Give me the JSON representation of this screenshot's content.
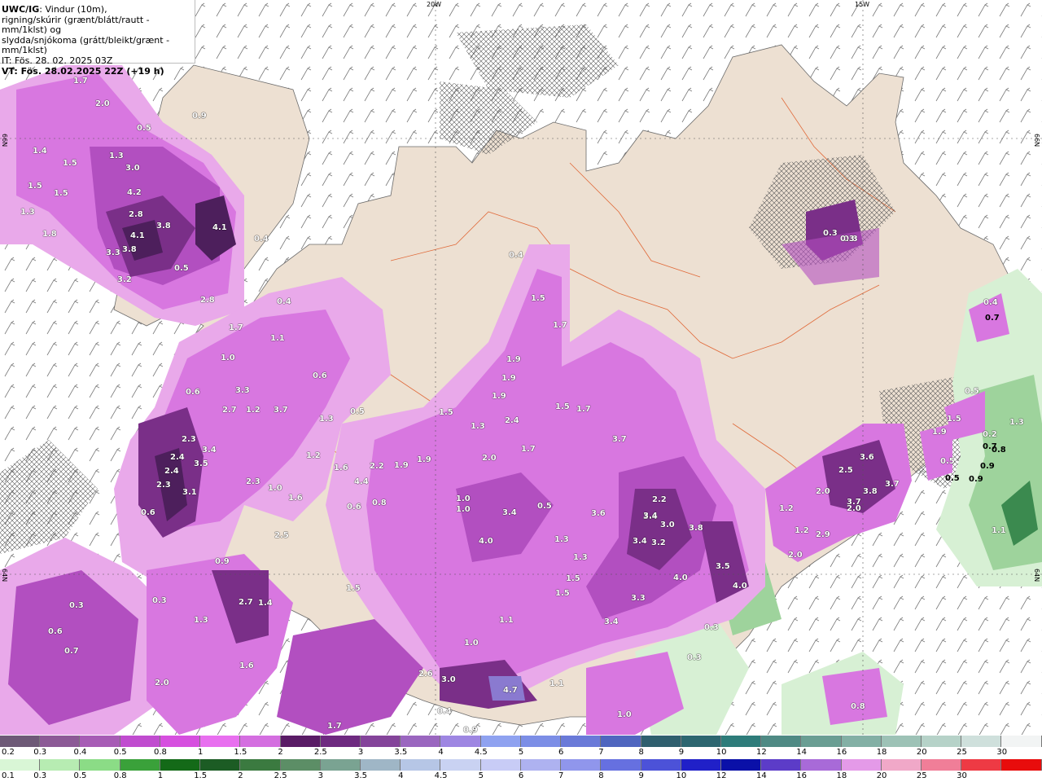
{
  "header": {
    "line1_bold": "UWC/IG",
    "line1_rest": ": Vindur (10m),",
    "line2": "rigning/skúrir (grænt/blátt/rautt - mm/1klst) og",
    "line3": "slydda/snjókoma (grátt/bleikt/grænt - mm/1klst)",
    "line4": "IT: Fös. 28. 02. 2025 03Z",
    "line5": "VT: Fös. 28.02.2025 22Z (+19 h)"
  },
  "grid_labels": {
    "lon_20w": "20W",
    "lon_15w": "15W",
    "lat_66n_left": "66N",
    "lat_66n_right": "66N",
    "lat_64n_left": "64N",
    "lat_64n_right": "64N"
  },
  "map_colors": {
    "sea": "#ffffff",
    "land": "#ede0d2",
    "roads": "#e06a3a",
    "snow_light": "#e9a9ea",
    "snow_mid": "#d877e0",
    "snow_strong": "#b24fc0",
    "snow_heavy": "#7a2f88",
    "snow_max": "#4d1f5c",
    "rain_light": "#d7f0d4",
    "rain_mid": "#9ed39c",
    "rain_heavy": "#3b8a4f"
  },
  "precip_labels": [
    {
      "text": "1.7",
      "c": "w"
    },
    {
      "text": "2.0",
      "c": "w"
    },
    {
      "text": "0.5",
      "c": "w"
    },
    {
      "text": "0.9",
      "c": "w"
    },
    {
      "text": "1.4",
      "c": "w"
    },
    {
      "text": "1.3",
      "c": "w"
    },
    {
      "text": "1.5",
      "c": "w"
    },
    {
      "text": "3.0",
      "c": "w"
    },
    {
      "text": "1.5",
      "c": "w"
    },
    {
      "text": "1.5",
      "c": "w"
    },
    {
      "text": "4.2",
      "c": "w"
    },
    {
      "text": "1.3",
      "c": "w"
    },
    {
      "text": "2.8",
      "c": "w"
    },
    {
      "text": "3.8",
      "c": "w"
    },
    {
      "text": "4.1",
      "c": "w"
    },
    {
      "text": "1.8",
      "c": "w"
    },
    {
      "text": "4.1",
      "c": "w"
    },
    {
      "text": "0.4",
      "c": "w"
    },
    {
      "text": "3.3",
      "c": "w"
    },
    {
      "text": "3.8",
      "c": "w"
    },
    {
      "text": "0.5",
      "c": "w"
    },
    {
      "text": "3.2",
      "c": "w"
    },
    {
      "text": "2.8",
      "c": "w"
    },
    {
      "text": "0.4",
      "c": "w"
    },
    {
      "text": "1.7",
      "c": "w"
    },
    {
      "text": "0.3",
      "c": "w"
    },
    {
      "text": "0.3",
      "c": "w"
    },
    {
      "text": "0.4",
      "c": "w"
    },
    {
      "text": "1.5",
      "c": "w"
    },
    {
      "text": "1.7",
      "c": "w"
    },
    {
      "text": "1.1",
      "c": "w"
    },
    {
      "text": "1.0",
      "c": "w"
    },
    {
      "text": "1.9",
      "c": "w"
    },
    {
      "text": "0.6",
      "c": "w"
    },
    {
      "text": "1.9",
      "c": "w"
    },
    {
      "text": "3.3",
      "c": "w"
    },
    {
      "text": "0.6",
      "c": "w"
    },
    {
      "text": "1.2",
      "c": "w"
    },
    {
      "text": "2.7",
      "c": "w"
    },
    {
      "text": "3.7",
      "c": "w"
    },
    {
      "text": "1.3",
      "c": "w"
    },
    {
      "text": "0.5",
      "c": "w"
    },
    {
      "text": "1.9",
      "c": "w"
    },
    {
      "text": "1.5",
      "c": "w"
    },
    {
      "text": "1.7",
      "c": "w"
    },
    {
      "text": "2.4",
      "c": "w"
    },
    {
      "text": "1.3",
      "c": "w"
    },
    {
      "text": "3.7",
      "c": "w"
    },
    {
      "text": "2.3",
      "c": "w"
    },
    {
      "text": "3.4",
      "c": "w"
    },
    {
      "text": "1.5",
      "c": "w"
    },
    {
      "text": "1.7",
      "c": "w"
    },
    {
      "text": "2.4",
      "c": "w"
    },
    {
      "text": "3.5",
      "c": "w"
    },
    {
      "text": "1.2",
      "c": "w"
    },
    {
      "text": "1.6",
      "c": "w"
    },
    {
      "text": "2.2",
      "c": "w"
    },
    {
      "text": "1.9",
      "c": "w"
    },
    {
      "text": "1.9",
      "c": "w"
    },
    {
      "text": "2.0",
      "c": "w"
    },
    {
      "text": "2.4",
      "c": "w"
    },
    {
      "text": "2.3",
      "c": "w"
    },
    {
      "text": "4.4",
      "c": "w"
    },
    {
      "text": "2.3",
      "c": "w"
    },
    {
      "text": "3.1",
      "c": "w"
    },
    {
      "text": "1.0",
      "c": "w"
    },
    {
      "text": "1.6",
      "c": "w"
    },
    {
      "text": "0.8",
      "c": "w"
    },
    {
      "text": "0.6",
      "c": "w"
    },
    {
      "text": "1.0",
      "c": "w"
    },
    {
      "text": "1.0",
      "c": "w"
    },
    {
      "text": "3.4",
      "c": "w"
    },
    {
      "text": "0.5",
      "c": "w"
    },
    {
      "text": "0.6",
      "c": "w"
    },
    {
      "text": "3.6",
      "c": "w"
    },
    {
      "text": "2.2",
      "c": "w"
    },
    {
      "text": "3.4",
      "c": "w"
    },
    {
      "text": "2.5",
      "c": "w"
    },
    {
      "text": "4.0",
      "c": "w"
    },
    {
      "text": "1.3",
      "c": "w"
    },
    {
      "text": "3.4",
      "c": "w"
    },
    {
      "text": "3.0",
      "c": "w"
    },
    {
      "text": "3.8",
      "c": "w"
    },
    {
      "text": "3.4",
      "c": "w"
    },
    {
      "text": "3.2",
      "c": "w"
    },
    {
      "text": "0.9",
      "c": "w"
    },
    {
      "text": "1.3",
      "c": "w"
    },
    {
      "text": "1.5",
      "c": "w"
    },
    {
      "text": "3.5",
      "c": "w"
    },
    {
      "text": "1.5",
      "c": "w"
    },
    {
      "text": "1.5",
      "c": "w"
    },
    {
      "text": "4.0",
      "c": "w"
    },
    {
      "text": "4.0",
      "c": "w"
    },
    {
      "text": "0.3",
      "c": "w"
    },
    {
      "text": "2.7",
      "c": "w"
    },
    {
      "text": "1.4",
      "c": "w"
    },
    {
      "text": "0.3",
      "c": "w"
    },
    {
      "text": "3.3",
      "c": "w"
    },
    {
      "text": "1.3",
      "c": "w"
    },
    {
      "text": "1.1",
      "c": "w"
    },
    {
      "text": "3.4",
      "c": "w"
    },
    {
      "text": "0.3",
      "c": "w"
    },
    {
      "text": "0.6",
      "c": "w"
    },
    {
      "text": "0.7",
      "c": "w"
    },
    {
      "text": "1.0",
      "c": "w"
    },
    {
      "text": "0.3",
      "c": "w"
    },
    {
      "text": "1.6",
      "c": "w"
    },
    {
      "text": "2.6",
      "c": "w"
    },
    {
      "text": "3.0",
      "c": "w"
    },
    {
      "text": "4.7",
      "c": "w"
    },
    {
      "text": "1.1",
      "c": "w"
    },
    {
      "text": "2.0",
      "c": "w"
    },
    {
      "text": "0.4",
      "c": "w"
    },
    {
      "text": "1.0",
      "c": "w"
    },
    {
      "text": "1.7",
      "c": "w"
    },
    {
      "text": "0.9",
      "c": "w"
    },
    {
      "text": "0.8",
      "c": "w"
    },
    {
      "text": "0.3",
      "c": "w"
    },
    {
      "text": "0.4",
      "c": "w"
    },
    {
      "text": "0.7",
      "c": "d"
    },
    {
      "text": "0.5",
      "c": "w"
    },
    {
      "text": "0.5",
      "c": "w"
    },
    {
      "text": "1.3",
      "c": "w"
    },
    {
      "text": "1.5",
      "c": "w"
    },
    {
      "text": "0.2",
      "c": "w"
    },
    {
      "text": "1.9",
      "c": "w"
    },
    {
      "text": "0.7",
      "c": "d"
    },
    {
      "text": "3.6",
      "c": "w"
    },
    {
      "text": "0.8",
      "c": "d"
    },
    {
      "text": "2.5",
      "c": "w"
    },
    {
      "text": "3.7",
      "c": "w"
    },
    {
      "text": "0.5",
      "c": "d"
    },
    {
      "text": "0.9",
      "c": "d"
    },
    {
      "text": "3.7",
      "c": "w"
    },
    {
      "text": "2.0",
      "c": "w"
    },
    {
      "text": "3.8",
      "c": "w"
    },
    {
      "text": "0.9",
      "c": "d"
    },
    {
      "text": "1.2",
      "c": "w"
    },
    {
      "text": "2.0",
      "c": "w"
    },
    {
      "text": "1.2",
      "c": "w"
    },
    {
      "text": "2.9",
      "c": "w"
    },
    {
      "text": "2.0",
      "c": "w"
    },
    {
      "text": "1.1",
      "c": "w"
    },
    {
      "text": "1.0",
      "c": "d"
    }
  ],
  "legend": {
    "snow": {
      "labels": [
        "0.2",
        "0.3",
        "0.4",
        "0.5",
        "0.8",
        "1",
        "1.5",
        "2",
        "2.5",
        "3",
        "3.5",
        "4",
        "4.5",
        "5",
        "6",
        "7",
        "8",
        "9",
        "10",
        "12",
        "14",
        "16",
        "18",
        "20",
        "25",
        "30"
      ],
      "colors": [
        "#6e5a77",
        "#8c5a96",
        "#a75cb5",
        "#c04ccf",
        "#d64fdf",
        "#e86fef",
        "#d46ee0",
        "#5a1c66",
        "#6e2a80",
        "#84449a",
        "#9a66bf",
        "#9e86e2",
        "#8fa2f0",
        "#7c8ee6",
        "#6a7ad8",
        "#4f66bf",
        "#2f5f6e",
        "#2d6670",
        "#2e7c7a",
        "#4f8a84",
        "#6a9e93",
        "#83b0a5",
        "#9dc2b6",
        "#b6d2c8",
        "#cfe0dc",
        "#f2f4f4"
      ]
    },
    "rain": {
      "labels": [
        "0.1",
        "0.3",
        "0.5",
        "0.8",
        "1",
        "1.5",
        "2",
        "2.5",
        "3",
        "3.5",
        "4",
        "4.5",
        "5",
        "6",
        "7",
        "8",
        "9",
        "10",
        "12",
        "14",
        "16",
        "18",
        "20",
        "25",
        "30"
      ],
      "colors": [
        "#d9f6d6",
        "#b7ecb2",
        "#8bdc86",
        "#3aa13a",
        "#146a18",
        "#1c5c24",
        "#3b7a40",
        "#5c8e66",
        "#7aa392",
        "#9fb6c6",
        "#b6c6e6",
        "#c9d2f2",
        "#c8ccf6",
        "#aeb2f0",
        "#9096ec",
        "#6670e0",
        "#4c52d8",
        "#2020c8",
        "#0a10a8",
        "#5c3cc8",
        "#a86ad8",
        "#e49ae8",
        "#f0a8c8",
        "#f07e98",
        "#ee3a44",
        "#e80c0c"
      ]
    }
  }
}
